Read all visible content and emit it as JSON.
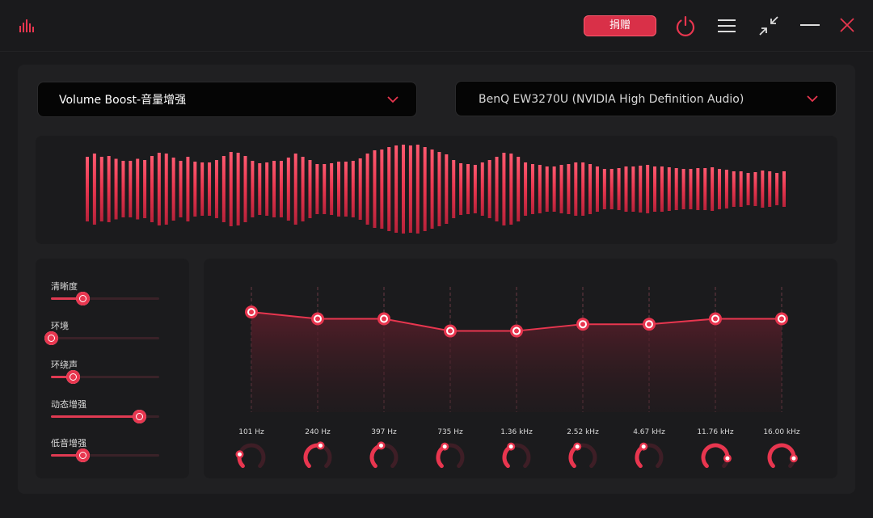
{
  "titlebar": {
    "donate_label": "捐赠",
    "icons": [
      "equalizer-logo-icon",
      "power-icon",
      "menu-icon",
      "shrink-icon",
      "minimize-icon",
      "close-icon"
    ],
    "accent": "#e8364f"
  },
  "preset_select": {
    "value": "Volume Boost-音量增强"
  },
  "device_select": {
    "value": "BenQ EW3270U (NVIDIA High Definition Audio)"
  },
  "waveform": {
    "heights": [
      80,
      88,
      80,
      82,
      75,
      70,
      70,
      75,
      72,
      82,
      90,
      88,
      78,
      70,
      80,
      68,
      66,
      66,
      72,
      82,
      92,
      90,
      82,
      70,
      64,
      66,
      70,
      70,
      78,
      88,
      80,
      72,
      62,
      62,
      64,
      68,
      68,
      70,
      76,
      88,
      96,
      98,
      104,
      108,
      110,
      108,
      110,
      104,
      98,
      92,
      86,
      72,
      64,
      62,
      60,
      66,
      72,
      80,
      90,
      88,
      80,
      66,
      62,
      60,
      56,
      56,
      60,
      62,
      66,
      66,
      62,
      56,
      50,
      50,
      52,
      56,
      56,
      58,
      60,
      56,
      56,
      54,
      52,
      50,
      50,
      52,
      52,
      54,
      50,
      48,
      44,
      44,
      40,
      42,
      46,
      44,
      40,
      44
    ]
  },
  "effects": [
    {
      "label": "清晰度",
      "value": 0.29
    },
    {
      "label": "环境",
      "value": 0.0
    },
    {
      "label": "环绕声",
      "value": 0.2
    },
    {
      "label": "动态增强",
      "value": 0.81
    },
    {
      "label": "低音增强",
      "value": 0.29
    }
  ],
  "equalizer": {
    "bands": [
      {
        "freq": "101 Hz",
        "gain": 0.74,
        "knob": 0.22
      },
      {
        "freq": "240 Hz",
        "gain": 0.69,
        "knob": 0.55
      },
      {
        "freq": "397 Hz",
        "gain": 0.69,
        "knob": 0.45
      },
      {
        "freq": "735 Hz",
        "gain": 0.6,
        "knob": 0.4
      },
      {
        "freq": "1.36 kHz",
        "gain": 0.6,
        "knob": 0.4
      },
      {
        "freq": "2.52 kHz",
        "gain": 0.65,
        "knob": 0.4
      },
      {
        "freq": "4.67 kHz",
        "gain": 0.65,
        "knob": 0.4
      },
      {
        "freq": "11.76 kHz",
        "gain": 0.69,
        "knob": 0.85
      },
      {
        "freq": "16.00 kHz",
        "gain": 0.69,
        "knob": 0.85
      }
    ]
  }
}
